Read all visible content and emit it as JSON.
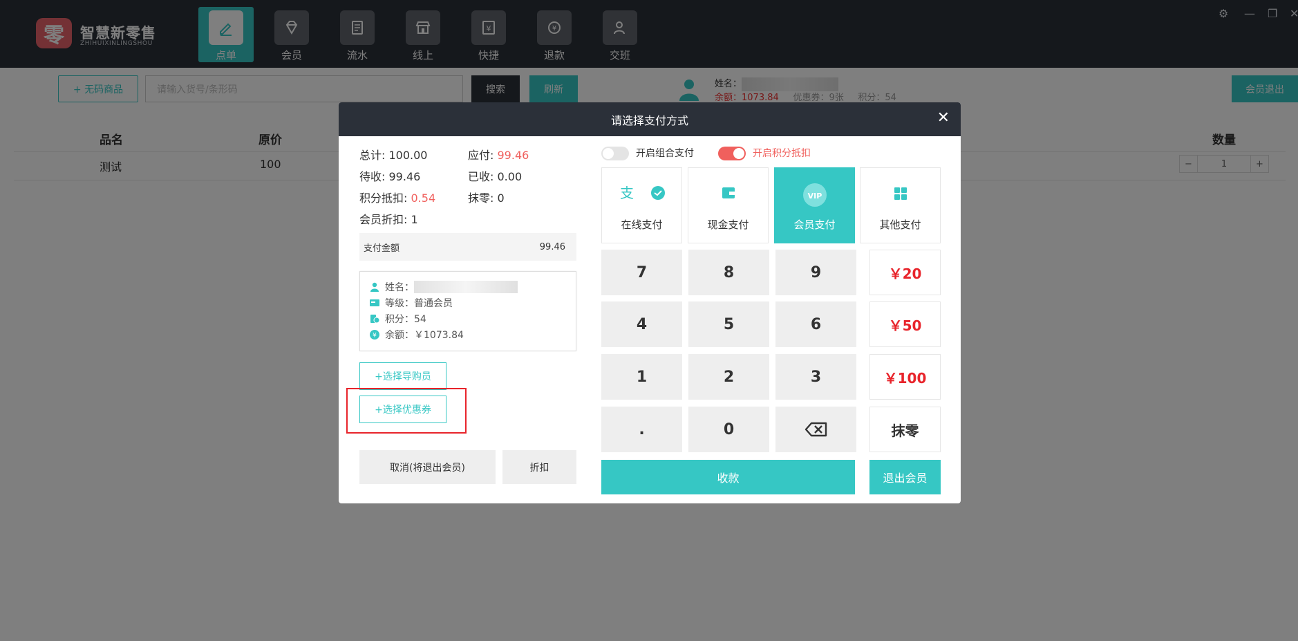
{
  "app": {
    "logo_char": "零",
    "name": "智慧新零售",
    "name_pinyin": "ZHIHUIXINLINGSHOU"
  },
  "nav": [
    {
      "label": "点单",
      "icon": "edit-icon",
      "active": true
    },
    {
      "label": "会员",
      "icon": "diamond-icon",
      "active": false
    },
    {
      "label": "流水",
      "icon": "document-icon",
      "active": false
    },
    {
      "label": "线上",
      "icon": "shop-icon",
      "active": false
    },
    {
      "label": "快捷",
      "icon": "yuan-receipt-icon",
      "active": false
    },
    {
      "label": "退款",
      "icon": "refund-icon",
      "active": false
    },
    {
      "label": "交班",
      "icon": "handover-icon",
      "active": false
    }
  ],
  "window_controls": [
    "settings-icon",
    "minimize-icon",
    "restore-icon",
    "close-icon"
  ],
  "toolbar": {
    "no_code_label": "+ 无码商品",
    "search_placeholder": "请输入货号/条形码",
    "search_label": "搜索",
    "refresh_label": "刷新",
    "member_logout_label": "会员退出"
  },
  "member_summary": {
    "name_label": "姓名：",
    "balance_text": "余额：1073.84",
    "coupon_text": "优惠券：9张",
    "points_text": "积分：54"
  },
  "table": {
    "headers": {
      "name": "品名",
      "price": "原价",
      "qty": "数量"
    },
    "rows": [
      {
        "name": "测试",
        "price": "100",
        "qty": "1"
      }
    ],
    "minus": "−",
    "plus": "+"
  },
  "modal": {
    "title": "请选择支付方式",
    "close": "✕",
    "summary": {
      "total_label": "总计:",
      "total": "100.00",
      "payable_label": "应付:",
      "payable": "99.46",
      "pending_label": "待收:",
      "pending": "99.46",
      "received_label": "已收:",
      "received": "0.00",
      "points_deduct_label": "积分抵扣:",
      "points_deduct": "0.54",
      "rounding_label": "抹零:",
      "rounding": "0",
      "member_discount_label": "会员折扣:",
      "member_discount": "1"
    },
    "pay_amount_label": "支付金额",
    "pay_amount": "99.46",
    "member_card": {
      "name_label": "姓名：",
      "level": "等级：普通会员",
      "points": "积分：54",
      "balance": "余额：￥1073.84"
    },
    "select_guide_label": "+选择导购员",
    "select_coupon_label": "+选择优惠券",
    "cancel_label": "取消(将退出会员)",
    "discount_label": "折扣",
    "combo_pay_label": "开启组合支付",
    "points_deduct_toggle_label": "开启积分抵扣",
    "pay_methods": [
      {
        "label": "在线支付",
        "active": false
      },
      {
        "label": "现金支付",
        "active": false
      },
      {
        "label": "会员支付",
        "active": true
      },
      {
        "label": "其他支付",
        "active": false
      }
    ],
    "keypad": [
      "7",
      "8",
      "9",
      "4",
      "5",
      "6",
      "1",
      "2",
      "3",
      ".",
      "0"
    ],
    "quick_amounts": [
      "￥20",
      "￥50",
      "￥100"
    ],
    "erase_label": "抹零",
    "collect_label": "收款",
    "exit_member_label": "退出会员"
  },
  "colors": {
    "accent": "#36c7c4",
    "header_dark": "#2b3039",
    "highlight_red": "#f0605d",
    "annotation_red": "#e8242b"
  }
}
